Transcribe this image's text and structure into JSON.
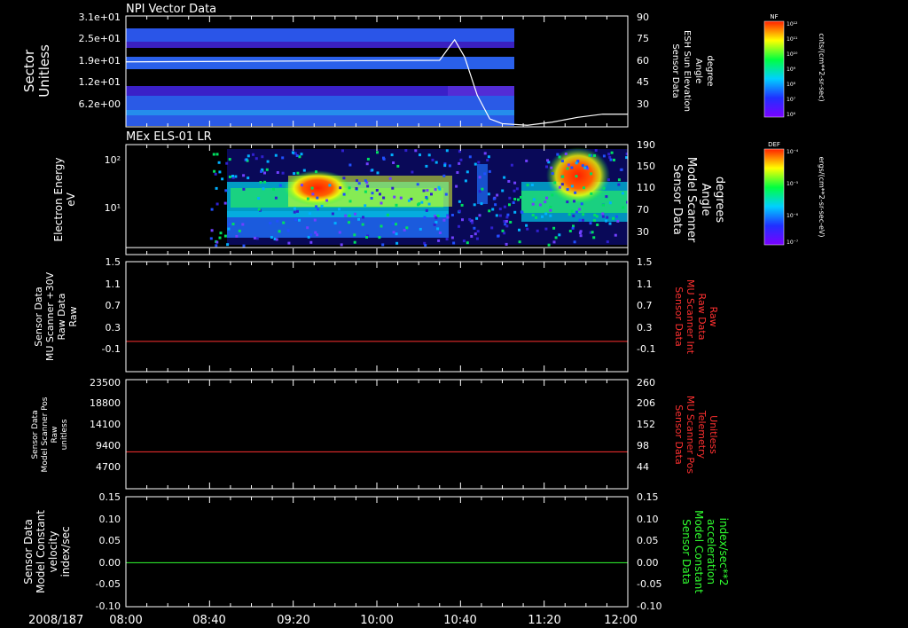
{
  "figure": {
    "date_label": "2008/187",
    "time_ticks": [
      "08:00",
      "08:40",
      "09:20",
      "10:00",
      "10:40",
      "11:20",
      "12:00"
    ],
    "time_range_hours": [
      8,
      12
    ]
  },
  "colors": {
    "axis": "#ffffff",
    "red_trace": "#ff3030",
    "green_trace": "#30ff30",
    "line_white": "#ffffff"
  },
  "chart_data": [
    {
      "type": "heatmap",
      "title": "NPI Vector Data",
      "ylabel": [
        "Sector",
        "Unitless"
      ],
      "y_ticks": [
        "3.1e+01",
        "2.5e+01",
        "1.9e+01",
        "1.2e+01",
        "6.2e+00"
      ],
      "right_ylabel": [
        "Sensor Data",
        "ESH Sun Elevation",
        "Angle",
        "degree"
      ],
      "right_ticks": [
        90,
        75,
        60,
        45,
        30
      ],
      "right_range": [
        20,
        90
      ],
      "data_end_time": 11.0,
      "overlay_line": {
        "name": "ESH Sun Elevation Angle",
        "x": [
          8.0,
          10.5,
          10.62,
          10.7,
          10.8,
          10.9,
          11.0,
          11.2,
          11.4,
          11.6,
          11.8,
          12.0
        ],
        "y": [
          61,
          62,
          75,
          64,
          40,
          25,
          22,
          21,
          23,
          26,
          28,
          28
        ]
      },
      "colorbar": {
        "label": "NF",
        "unit": "cnts/(cm**2-sr-sec)",
        "ticks": [
          "10¹²",
          "10¹¹",
          "10¹⁰",
          "10⁹",
          "10⁸",
          "10⁷",
          "10⁶"
        ]
      }
    },
    {
      "type": "heatmap",
      "title": "MEx ELS-01 LR",
      "ylabel": [
        "Electron Energy",
        "eV"
      ],
      "y_ticks": [
        "10²",
        "10¹"
      ],
      "right_ylabel": [
        "Sensor Data",
        "Model Scanner",
        "Angle",
        "degrees"
      ],
      "right_ticks": [
        190,
        150,
        110,
        70,
        30
      ],
      "right_range": [
        0,
        190
      ],
      "data_start_time": 8.67,
      "overlay_line": {
        "name": "Model Scanner Angle",
        "x": [
          8.0,
          12.0
        ],
        "y": [
          12,
          12
        ]
      },
      "colorbar": {
        "label": "DEF",
        "unit": "ergs/(cm**2-sr-sec-eV)",
        "ticks": [
          "10⁻⁴",
          "10⁻⁵",
          "10⁻⁶",
          "10⁻⁷"
        ]
      }
    },
    {
      "type": "line",
      "ylabel": [
        "Sensor Data",
        "MU Scanner +30V",
        "Raw Data",
        "Raw"
      ],
      "y_ticks": [
        "1.5",
        "1.1",
        "0.7",
        "0.3",
        "-0.1"
      ],
      "ylim": [
        -0.5,
        1.5
      ],
      "right_ylabel": [
        "Sensor Data",
        "MU Scanner Int",
        "Raw Data",
        "Raw"
      ],
      "right_ticks": [
        "1.5",
        "1.1",
        "0.7",
        "0.3",
        "-0.1"
      ],
      "series": [
        {
          "x": [
            8.0,
            12.0
          ],
          "y": [
            0.05,
            0.05
          ],
          "color": "#ff3030"
        }
      ]
    },
    {
      "type": "line",
      "ylabel": [
        "Sensor Data",
        "Model Scanner Pos",
        "Raw",
        "unitless"
      ],
      "y_ticks": [
        "23500",
        "18800",
        "14100",
        "9400",
        "4700"
      ],
      "ylim": [
        0,
        23500
      ],
      "right_ylabel": [
        "Sensor Data",
        "MU Scanner Pos",
        "Telemetry",
        "Unitless"
      ],
      "right_ticks": [
        "260",
        "206",
        "152",
        "98",
        "44"
      ],
      "series": [
        {
          "x": [
            8.0,
            12.0
          ],
          "y": [
            7950,
            7950
          ],
          "color": "#ff3030"
        }
      ]
    },
    {
      "type": "line",
      "ylabel": [
        "Sensor Data",
        "Model Constant",
        "velocity",
        "index/sec"
      ],
      "y_ticks": [
        "0.15",
        "0.10",
        "0.05",
        "0.00",
        "-0.05",
        "-0.10"
      ],
      "ylim": [
        -0.1,
        0.15
      ],
      "right_ylabel": [
        "Sensor Data",
        "Model Constant",
        "acceleration",
        "index/sec**2"
      ],
      "right_ticks": [
        "0.15",
        "0.10",
        "0.05",
        "0.00",
        "-0.05",
        "-0.10"
      ],
      "series": [
        {
          "x": [
            8.0,
            12.0
          ],
          "y": [
            0.0,
            0.0
          ],
          "color": "#30ff30"
        }
      ]
    }
  ]
}
